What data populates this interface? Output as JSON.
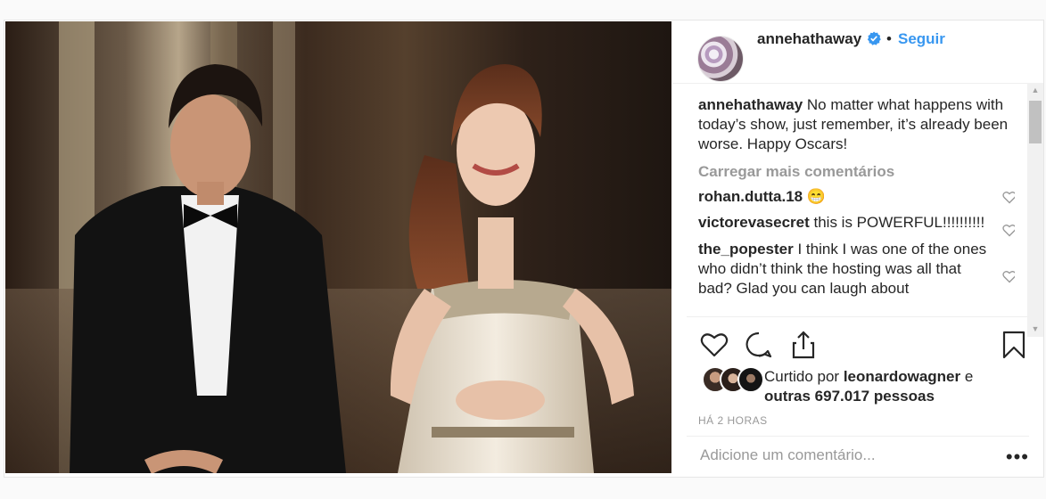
{
  "post": {
    "username": "annehathaway",
    "dot": "•",
    "follow_label": "Seguir",
    "caption": {
      "user": "annehathaway",
      "text": " No matter what happens with today’s show, just remember, it’s already been worse. Happy Oscars!"
    },
    "load_more": "Carregar mais comentários",
    "comments": [
      {
        "user": "rohan.dutta.18",
        "text": " 😁"
      },
      {
        "user": "victorevasecret",
        "text": " this is POWERFUL!!!!!!!!!!"
      },
      {
        "user": "the_popester",
        "text": " I think I was one of the ones who didn’t think the hosting was all that bad? Glad you can laugh about"
      }
    ],
    "likes": {
      "prefix": "Curtido por ",
      "user": "leonardowagner",
      "middle": " e",
      "others": "outras 697.017 pessoas"
    },
    "time": "HÁ 2 HORAS",
    "add_comment_placeholder": "Adicione um comentário...",
    "more": "•••"
  },
  "icons": {
    "verified": "verified-badge-icon",
    "like": "heart-icon",
    "comment": "comment-bubble-icon",
    "share": "share-icon",
    "save": "bookmark-icon"
  },
  "colors": {
    "link": "#3897f0",
    "muted": "#999999",
    "text": "#262626",
    "verified": "#3897f0"
  }
}
